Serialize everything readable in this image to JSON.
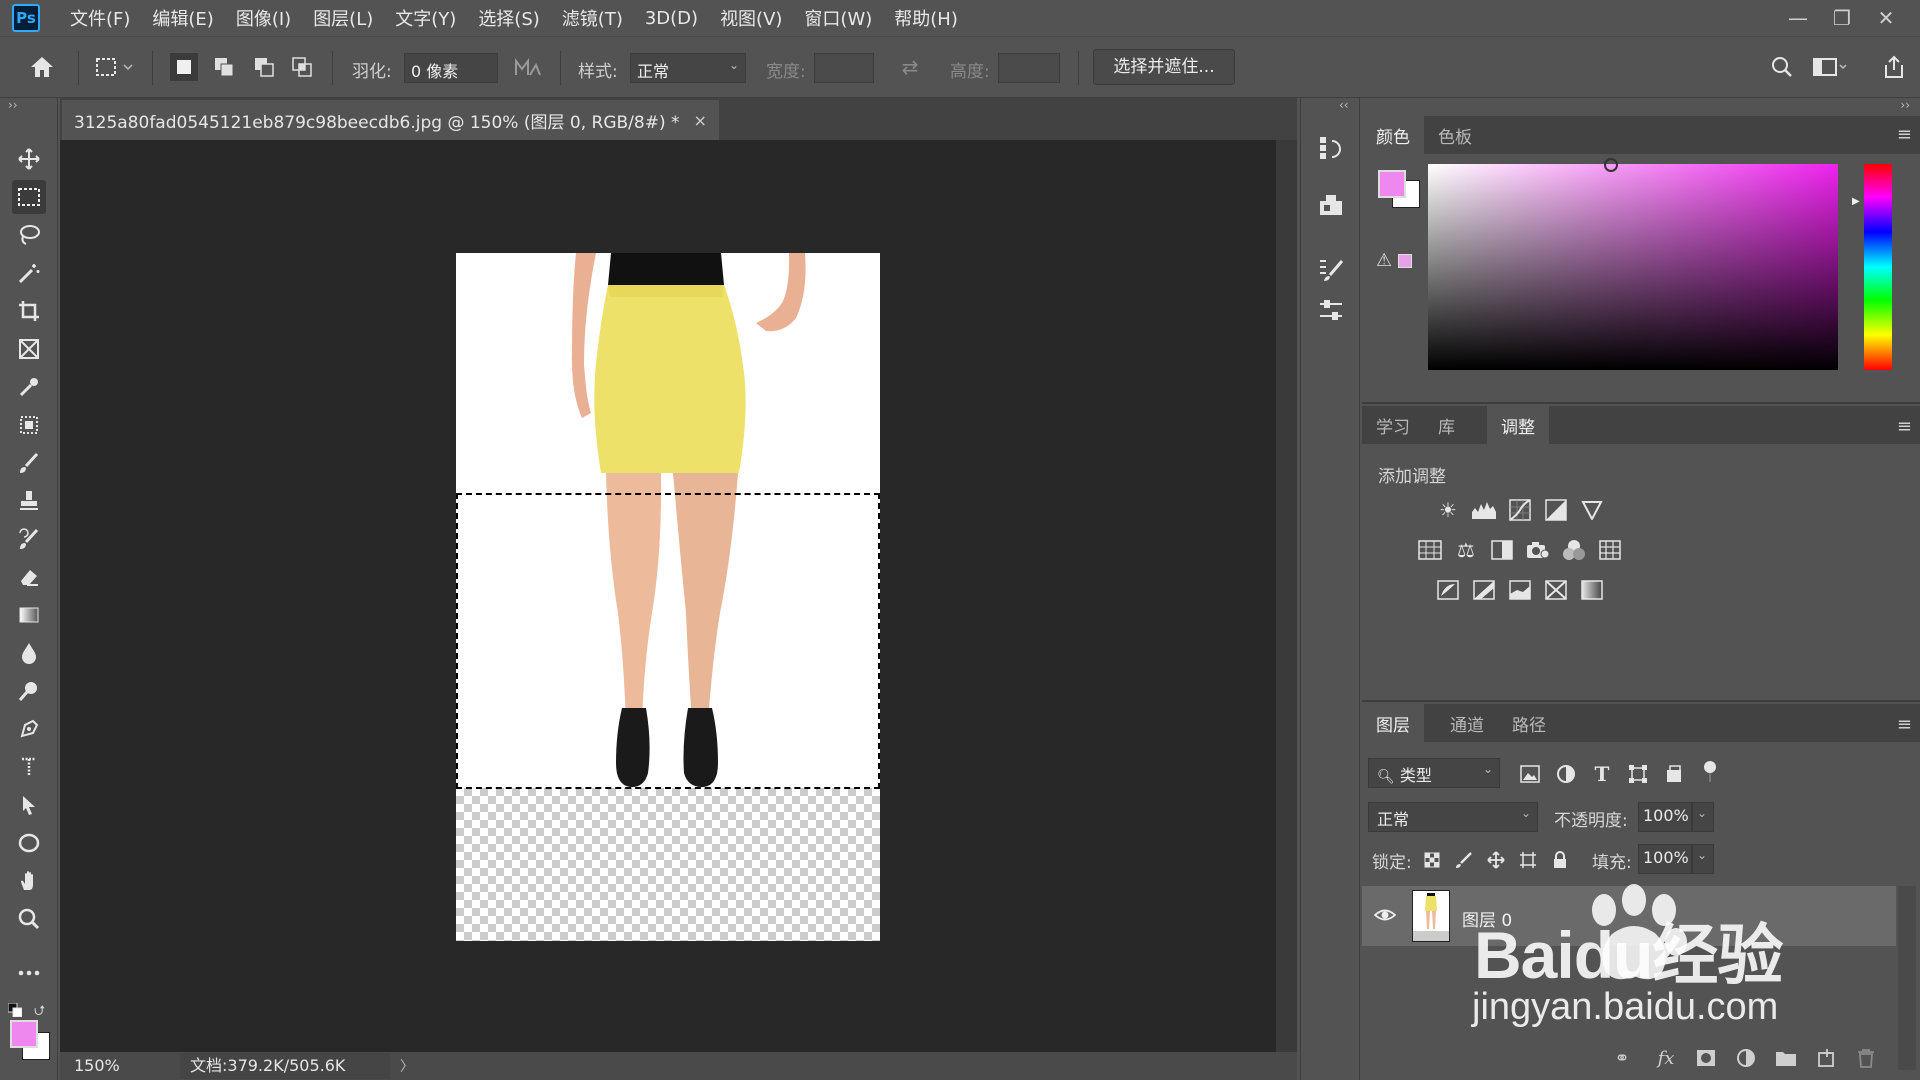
{
  "app": {
    "logo_text": "Ps"
  },
  "menu": [
    "文件(F)",
    "编辑(E)",
    "图像(I)",
    "图层(L)",
    "文字(Y)",
    "选择(S)",
    "滤镜(T)",
    "3D(D)",
    "视图(V)",
    "窗口(W)",
    "帮助(H)"
  ],
  "window_controls": {
    "minimize": "—",
    "restore": "❐",
    "close": "✕"
  },
  "options": {
    "feather_label": "羽化:",
    "feather_value": "0 像素",
    "style_label": "样式:",
    "style_value": "正常",
    "width_label": "宽度:",
    "height_label": "高度:",
    "select_mask_label": "选择并遮住..."
  },
  "document": {
    "tab_title": "3125a80fad0545121eb879c98beecdb6.jpg @ 150% (图层 0, RGB/8#) *",
    "tab_close": "×"
  },
  "status": {
    "zoom": "150%",
    "doc_info": "文档:379.2K/505.6K",
    "arrow": "〉"
  },
  "color_panel": {
    "tabs": [
      "颜色",
      "色板"
    ],
    "active_tab": 0,
    "foreground_color": "#ee88ee",
    "background_color": "#ffffff"
  },
  "adjust_panel": {
    "tabs": [
      "学习",
      "库",
      "调整"
    ],
    "active_tab": 2,
    "heading": "添加调整"
  },
  "layers_panel": {
    "tabs": [
      "图层",
      "通道",
      "路径"
    ],
    "active_tab": 0,
    "filter_kind": "类型",
    "blend_mode": "正常",
    "opacity_label": "不透明度:",
    "opacity_value": "100%",
    "lock_label": "锁定:",
    "fill_label": "填充:",
    "fill_value": "100%",
    "layers": [
      {
        "name": "图层 0",
        "visible": true
      }
    ]
  },
  "watermark": {
    "line1": "Baidu经验",
    "line2": "jingyan.baidu.com"
  }
}
